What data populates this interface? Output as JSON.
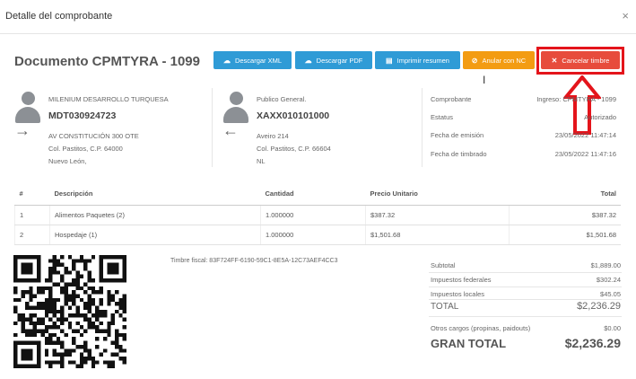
{
  "modal": {
    "title": "Detalle del comprobante",
    "close": "×"
  },
  "document": {
    "title": "Documento CPMTYRA - 1099"
  },
  "buttons": [
    {
      "icon": "☁",
      "label": "Descargar XML",
      "color": "#2f9bd6"
    },
    {
      "icon": "☁",
      "label": "Descargar PDF",
      "color": "#2f9bd6"
    },
    {
      "icon": "▤",
      "label": "Imprimir resumen",
      "color": "#2f9bd6"
    },
    {
      "icon": "⊘",
      "label": "Anular con NC",
      "color": "#f39c12"
    },
    {
      "icon": "✕",
      "label": "Cancelar timbre",
      "color": "#e74c3c"
    }
  ],
  "emitter": {
    "name": "MILENIUM DESARROLLO TURQUESA",
    "rfc": "MDT030924723",
    "address1": "AV CONSTITUCIÓN 300 OTE",
    "address2": "Col. Pastitos, C.P. 64000",
    "address3": "Nuevo León,"
  },
  "receiver": {
    "name": "Publico General.",
    "rfc": "XAXX010101000",
    "address1": "Aveiro 214",
    "address2": "Col. Pastitos, C.P. 66604",
    "address3": "NL"
  },
  "meta": {
    "comprobante_label": "Comprobante",
    "comprobante_value": "Ingreso: CPMTYRA - 1099",
    "estatus_label": "Estatus",
    "estatus_value": "Autorizado",
    "emision_label": "Fecha de emisión",
    "emision_value": "23/05/2022 11:47:14",
    "timbrado_label": "Fecha de timbrado",
    "timbrado_value": "23/05/2022 11:47:16"
  },
  "table": {
    "headers": [
      "#",
      "Descripción",
      "Cantidad",
      "Precio Unitario",
      "Total"
    ],
    "rows": [
      [
        "1",
        "Alimentos Paquetes (2)",
        "1.000000",
        "$387.32",
        "$387.32"
      ],
      [
        "2",
        "Hospedaje (1)",
        "1.000000",
        "$1,501.68",
        "$1,501.68"
      ]
    ]
  },
  "timbre": {
    "text": "Timbre fiscal: 83F724FF-6190-59C1-8E5A-12C73AEF4CC3"
  },
  "totals": {
    "subtotal_label": "Subtotal",
    "subtotal": "$1,889.00",
    "fed_label": "Impuestos federales",
    "fed": "$302.24",
    "loc_label": "Impuestos locales",
    "loc": "$45.05",
    "total_label": "TOTAL",
    "total": "$2,236.29",
    "otros_label": "Otros cargos (propinas, paidouts)",
    "otros": "$0.00",
    "gran_label": "GRAN TOTAL",
    "gran": "$2,236.29"
  },
  "colors": {
    "primary": "#2f9bd6",
    "warning": "#f39c12",
    "danger": "#e74c3c",
    "highlight": "#e4141b"
  }
}
